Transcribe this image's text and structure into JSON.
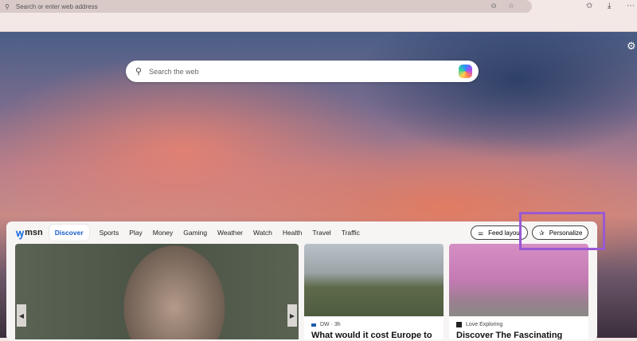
{
  "browser": {
    "address_placeholder": "Search or enter web address"
  },
  "search": {
    "placeholder": "Search the web"
  },
  "msn": {
    "logo": "msn",
    "tabs": [
      "Discover",
      "Sports",
      "Play",
      "Money",
      "Gaming",
      "Weather",
      "Watch",
      "Health",
      "Travel",
      "Traffic"
    ],
    "feed_layout": "Feed layout",
    "personalize": "Personalize"
  },
  "cards": [
    {
      "source": "DW · 3h",
      "title": "What would it cost Europe to"
    },
    {
      "source": "Love Exploring",
      "title": "Discover The Fascinating"
    }
  ],
  "colors": {
    "highlight": "#9a58d3",
    "accent": "#1a5fc8"
  }
}
